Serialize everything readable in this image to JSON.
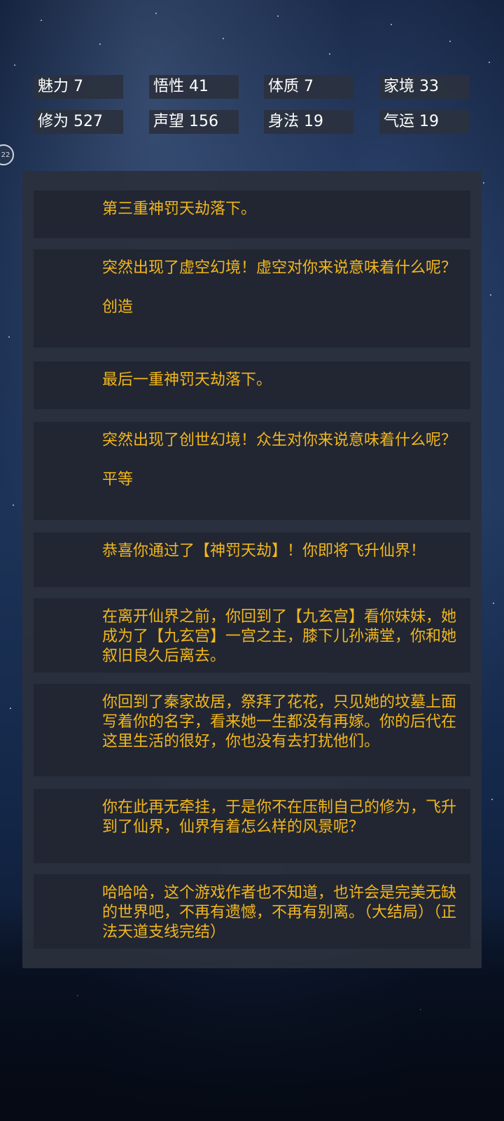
{
  "badge": "22",
  "stats": [
    {
      "label": "魅力",
      "value": "7"
    },
    {
      "label": "悟性",
      "value": "41"
    },
    {
      "label": "体质",
      "value": "7"
    },
    {
      "label": "家境",
      "value": "33"
    },
    {
      "label": "修为",
      "value": "527"
    },
    {
      "label": "声望",
      "value": "156"
    },
    {
      "label": "身法",
      "value": "19"
    },
    {
      "label": "气运",
      "value": "19"
    }
  ],
  "log": [
    "第三重神罚天劫落下。",
    "突然出现了虚空幻境！虚空对你来说意味着什么呢？\n\n创造",
    "最后一重神罚天劫落下。",
    "突然出现了创世幻境！众生对你来说意味着什么呢？\n\n平等",
    "恭喜你通过了【神罚天劫】！你即将飞升仙界！",
    "在离开仙界之前，你回到了【九玄宫】看你妹妹，她成为了【九玄宫】一宫之主，膝下儿孙满堂，你和她叙旧良久后离去。",
    "你回到了秦家故居，祭拜了花花，只见她的坟墓上面写着你的名字，看来她一生都没有再嫁。你的后代在这里生活的很好，你也没有去打扰他们。",
    "你在此再无牵挂，于是你不在压制自己的修为，飞升到了仙界，仙界有着怎么样的风景呢？",
    "哈哈哈，这个游戏作者也不知道，也许会是完美无缺的世界吧，不再有遗憾，不再有别离。（大结局）（正法天道支线完结）"
  ],
  "colors": {
    "text": "#f3b71d",
    "card": "#212632",
    "panel": "#2b303c",
    "stat_bg": "#2b313e"
  }
}
